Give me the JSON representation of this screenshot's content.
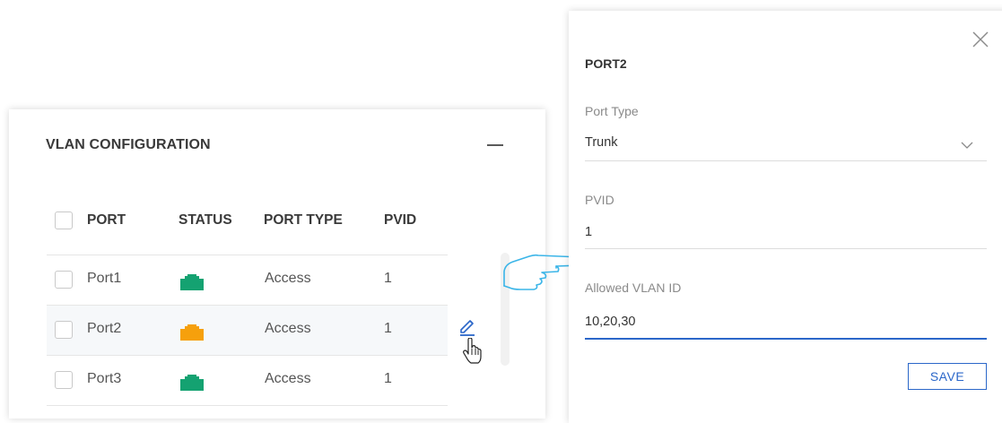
{
  "vlan_card": {
    "title": "VLAN CONFIGURATION",
    "columns": [
      "PORT",
      "STATUS",
      "PORT TYPE",
      "PVID"
    ],
    "rows": [
      {
        "port": "Port1",
        "status_color": "#14a271",
        "port_type": "Access",
        "pvid": "1"
      },
      {
        "port": "Port2",
        "status_color": "#f6a00c",
        "port_type": "Access",
        "pvid": "1"
      },
      {
        "port": "Port3",
        "status_color": "#14a271",
        "port_type": "Access",
        "pvid": "1"
      }
    ]
  },
  "port_panel": {
    "title": "PORT2",
    "port_type": {
      "label": "Port Type",
      "value": "Trunk"
    },
    "pvid": {
      "label": "PVID",
      "value": "1"
    },
    "allowed_vlan": {
      "label": "Allowed VLAN ID",
      "value": "10,20,30"
    },
    "save_label": "SAVE"
  },
  "colors": {
    "accent": "#2b67c9",
    "status_green": "#14a271",
    "status_orange": "#f6a00c",
    "hand_outline": "#3bb5e8"
  },
  "icons": [
    "minimize-icon",
    "edit-icon",
    "hand-cursor-icon",
    "pointing-hand-icon",
    "close-icon",
    "chevron-down-icon"
  ]
}
